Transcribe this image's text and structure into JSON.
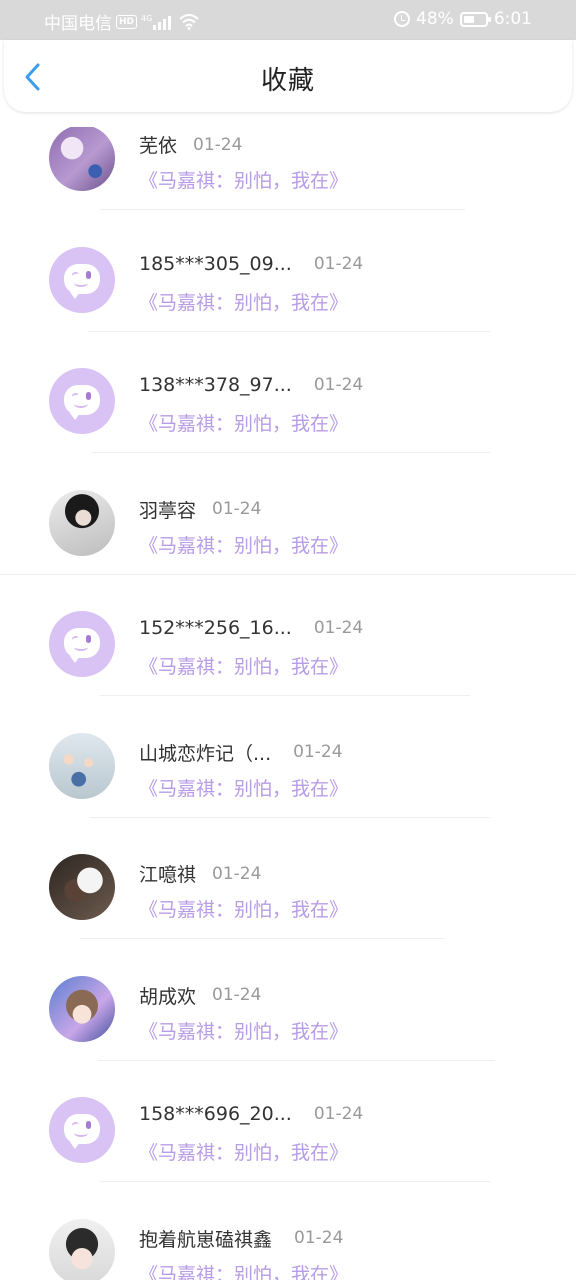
{
  "status_bar": {
    "carrier": "中国电信",
    "hd": "HD",
    "network": "4G",
    "battery": "48%",
    "time": "6:01"
  },
  "header": {
    "title": "收藏"
  },
  "colors": {
    "accent_link": "#b79ce6",
    "placeholder_avatar_bg": "#d9c3f5"
  },
  "favorites": [
    {
      "name": "芜依",
      "date": "01-24",
      "work": "《马嘉祺：别怕，我在》",
      "avatar": "photo-purple"
    },
    {
      "name": "185***305_09...",
      "date": "01-24",
      "work": "《马嘉祺：别怕，我在》",
      "avatar": "default-chat-bubble"
    },
    {
      "name": "138***378_97...",
      "date": "01-24",
      "work": "《马嘉祺：别怕，我在》",
      "avatar": "default-chat-bubble"
    },
    {
      "name": "羽葶容",
      "date": "01-24",
      "work": "《马嘉祺：别怕，我在》",
      "avatar": "photo-dark"
    },
    {
      "name": "152***256_16...",
      "date": "01-24",
      "work": "《马嘉祺：别怕，我在》",
      "avatar": "default-chat-bubble"
    },
    {
      "name": "山城恋炸记（...",
      "date": "01-24",
      "work": "《马嘉祺：别怕，我在》",
      "avatar": "photo-group"
    },
    {
      "name": "江噫祺",
      "date": "01-24",
      "work": "《马嘉祺：别怕，我在》",
      "avatar": "photo-white-hair"
    },
    {
      "name": "胡成欢",
      "date": "01-24",
      "work": "《马嘉祺：别怕，我在》",
      "avatar": "photo-anime"
    },
    {
      "name": "158***696_20...",
      "date": "01-24",
      "work": "《马嘉祺：别怕，我在》",
      "avatar": "default-chat-bubble"
    },
    {
      "name": "抱着航崽磕祺鑫",
      "date": "01-24",
      "work": "《马嘉祺：别怕，我在》",
      "avatar": "photo-boy"
    }
  ]
}
